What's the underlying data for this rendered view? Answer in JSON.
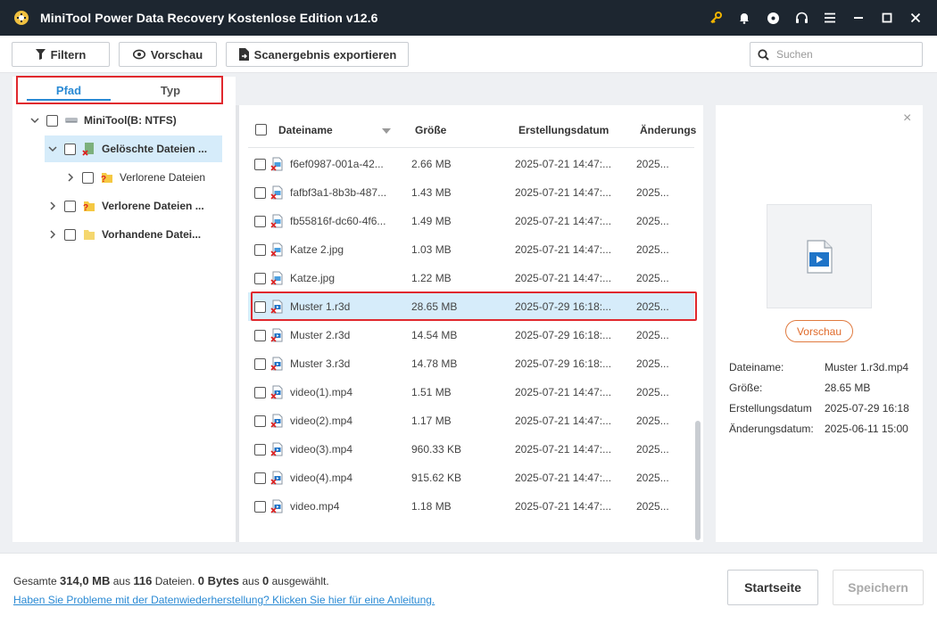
{
  "app": {
    "title": "MiniTool Power Data Recovery Kostenlose Edition v12.6"
  },
  "toolbar": {
    "filter_label": "Filtern",
    "preview_label": "Vorschau",
    "export_label": "Scanergebnis exportieren",
    "search_placeholder": "Suchen"
  },
  "tabs": {
    "path": "Pfad",
    "type": "Typ"
  },
  "tree": {
    "root": "MiniTool(B: NTFS)",
    "deleted": "Gelöschte Dateien ...",
    "lost_sub": "Verlorene Dateien",
    "lost": "Verlorene Dateien ...",
    "existing": "Vorhandene Datei..."
  },
  "columns": {
    "name": "Dateiname",
    "size": "Größe",
    "created": "Erstellungsdatum",
    "modified": "Änderungs"
  },
  "files": [
    {
      "name": "f6ef0987-001a-42...",
      "size": "2.66 MB",
      "created": "2025-07-21 14:47:...",
      "modified": "2025...",
      "type": "image"
    },
    {
      "name": "fafbf3a1-8b3b-487...",
      "size": "1.43 MB",
      "created": "2025-07-21 14:47:...",
      "modified": "2025...",
      "type": "image"
    },
    {
      "name": "fb55816f-dc60-4f6...",
      "size": "1.49 MB",
      "created": "2025-07-21 14:47:...",
      "modified": "2025...",
      "type": "image"
    },
    {
      "name": "Katze 2.jpg",
      "size": "1.03 MB",
      "created": "2025-07-21 14:47:...",
      "modified": "2025...",
      "type": "image"
    },
    {
      "name": "Katze.jpg",
      "size": "1.22 MB",
      "created": "2025-07-21 14:47:...",
      "modified": "2025...",
      "type": "image"
    },
    {
      "name": "Muster 1.r3d",
      "size": "28.65 MB",
      "created": "2025-07-29 16:18:...",
      "modified": "2025...",
      "type": "video"
    },
    {
      "name": "Muster 2.r3d",
      "size": "14.54 MB",
      "created": "2025-07-29 16:18:...",
      "modified": "2025...",
      "type": "video"
    },
    {
      "name": "Muster 3.r3d",
      "size": "14.78 MB",
      "created": "2025-07-29 16:18:...",
      "modified": "2025...",
      "type": "video"
    },
    {
      "name": "video(1).mp4",
      "size": "1.51 MB",
      "created": "2025-07-21 14:47:...",
      "modified": "2025...",
      "type": "video"
    },
    {
      "name": "video(2).mp4",
      "size": "1.17 MB",
      "created": "2025-07-21 14:47:...",
      "modified": "2025...",
      "type": "video"
    },
    {
      "name": "video(3).mp4",
      "size": "960.33 KB",
      "created": "2025-07-21 14:47:...",
      "modified": "2025...",
      "type": "video"
    },
    {
      "name": "video(4).mp4",
      "size": "915.62 KB",
      "created": "2025-07-21 14:47:...",
      "modified": "2025...",
      "type": "video"
    },
    {
      "name": "video.mp4",
      "size": "1.18 MB",
      "created": "2025-07-21 14:47:...",
      "modified": "2025...",
      "type": "video"
    }
  ],
  "preview": {
    "button": "Vorschau",
    "name_label": "Dateiname:",
    "name_value": "Muster 1.r3d.mp4",
    "size_label": "Größe:",
    "size_value": "28.65 MB",
    "created_label": "Erstellungsdatum",
    "created_value": "2025-07-29 16:18",
    "modified_label": "Änderungsdatum:",
    "modified_value": "2025-06-11 15:00"
  },
  "footer": {
    "s1": "Gesamte ",
    "total_size": "314,0 MB",
    "s2": " aus ",
    "total_files": "116",
    "s3": " Dateien.  ",
    "sel_size": "0 Bytes",
    "s4": " aus ",
    "sel_files": "0",
    "s5": " ausgewählt.",
    "help": "Haben Sie Probleme mit der Datenwiederherstellung? Klicken Sie hier für eine Anleitung.",
    "home_button": "Startseite",
    "save_button": "Speichern"
  },
  "colors": {
    "titlebar": "#1d2630",
    "accent": "#2a8ad4",
    "highlight": "#e0282e",
    "selected_row": "#d6ecfa",
    "key_icon": "#f0b400"
  }
}
